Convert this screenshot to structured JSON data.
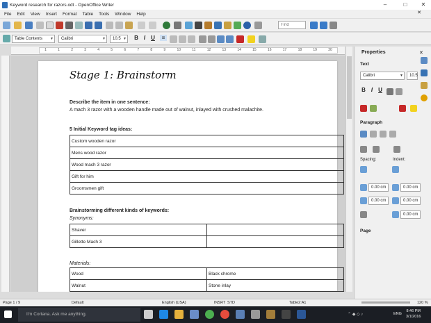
{
  "window": {
    "title": "Keyword research for razors.odt - OpenOffice Writer",
    "minimize_glyph": "–",
    "maximize_glyph": "□",
    "close_glyph": "✕"
  },
  "menu": [
    "File",
    "Edit",
    "View",
    "Insert",
    "Format",
    "Table",
    "Tools",
    "Window",
    "Help"
  ],
  "menu_close_glyph": "✕",
  "toolbar": {
    "find_placeholder": "Find",
    "paragraph_style": "Table Contents",
    "font_name": "Calibri",
    "font_size": "10.5",
    "bold_label": "B",
    "italic_label": "I",
    "underline_label": "U",
    "align_left_label": "≡"
  },
  "ruler": [
    "1",
    "1",
    "2",
    "3",
    "4",
    "5",
    "6",
    "7",
    "8",
    "9",
    "10",
    "11",
    "12",
    "13",
    "14",
    "15",
    "16",
    "17",
    "18",
    "19",
    "20"
  ],
  "document": {
    "stage_title": "Stage 1: Brainstorm",
    "describe_label": "Describe the item in one sentence:",
    "describe_text": "A mach 3 razor with a wooden handle made out of walnut, inlayed with crushed malachite.",
    "tags_label": "5 Initial Keyword tag ideas:",
    "tags": [
      "Custom wooden razor",
      "Mens wood razor",
      "Wood mach 3 razor",
      "Gift for him",
      "Groomsmen gift"
    ],
    "brainstorm_label": "Brainstorming different kinds of keywords:",
    "synonyms_label": "Synonyms:",
    "synonyms": [
      [
        "Shaver",
        ""
      ],
      [
        "Gillette Mach 3",
        ""
      ]
    ],
    "materials_label": "Materials:",
    "materials": [
      [
        "Wood",
        "Black chrome"
      ],
      [
        "Walnut",
        "Stone inlay"
      ]
    ]
  },
  "sidebar": {
    "title": "Properties",
    "close_glyph": "✕",
    "text_section": "Text",
    "font_name": "Calibri",
    "font_size": "10.5",
    "bold_label": "B",
    "italic_label": "I",
    "underline_label": "U",
    "paragraph_section": "Paragraph",
    "spacing_label": "Spacing:",
    "indent_label": "Indent:",
    "spacing_above": "0.00 cm",
    "spacing_below": "0.00 cm",
    "indent_before": "0.00 cm",
    "indent_after": "0.00 cm",
    "indent_first": "0.00 cm",
    "page_section": "Page"
  },
  "status": {
    "page": "Page 1 / 9",
    "style": "Default",
    "language": "English (USA)",
    "insert_mode": "INSRT",
    "selection_mode": "STD",
    "cell": "Table2:A1",
    "zoom": "120 %"
  },
  "taskbar": {
    "search_placeholder": "I'm Cortana. Ask me anything.",
    "language": "ENG",
    "time": "8:46 PM",
    "date": "3/1/2016"
  },
  "colors": {
    "accent": "#2f6fb6",
    "taskbar": "#1b1e24"
  }
}
